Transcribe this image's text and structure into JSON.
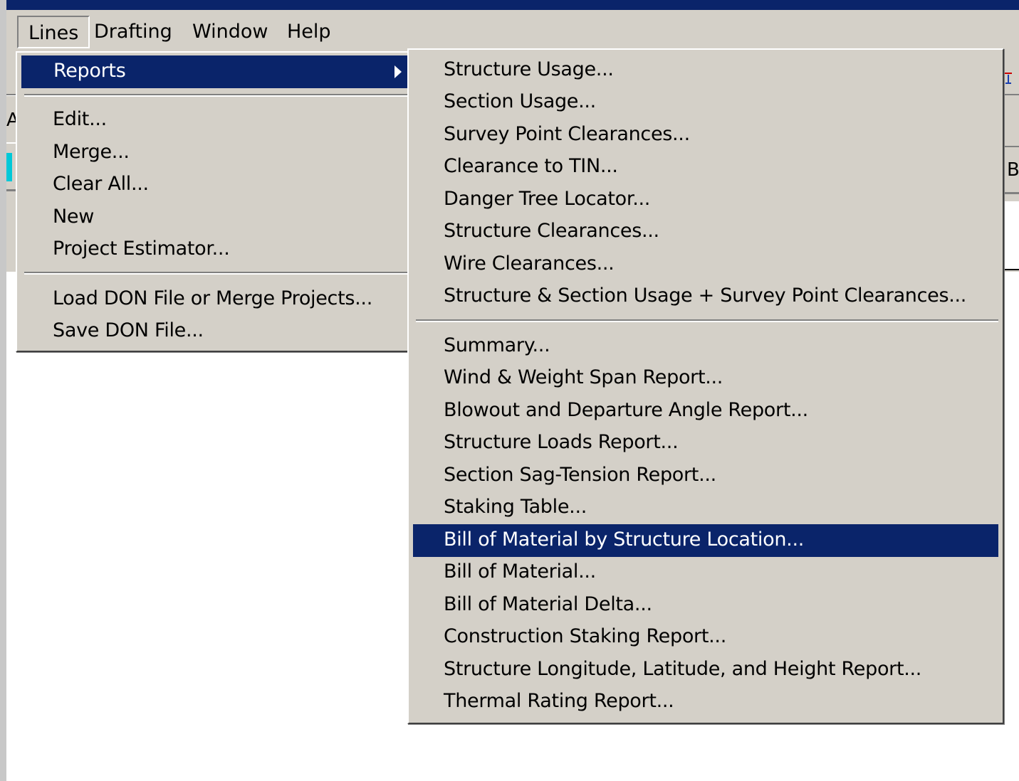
{
  "menubar": {
    "items": [
      {
        "label": "Lines"
      },
      {
        "label": "Drafting"
      },
      {
        "label": "Window"
      },
      {
        "label": "Help"
      }
    ]
  },
  "background": {
    "left_edge_text": "Al",
    "right_edge_text": "B"
  },
  "lines_menu": {
    "reports": "Reports",
    "edit": "Edit...",
    "merge": "Merge...",
    "clear_all": "Clear All...",
    "new": "New",
    "project_estimator": "Project Estimator...",
    "load_don": "Load DON File or Merge Projects...",
    "save_don": "Save DON File..."
  },
  "reports_menu": {
    "items": [
      "Structure Usage...",
      "Section Usage...",
      "Survey Point Clearances...",
      "Clearance to TIN...",
      "Danger Tree Locator...",
      "Structure Clearances...",
      "Wire Clearances...",
      "Structure & Section Usage + Survey Point Clearances...",
      "Summary...",
      "Wind & Weight Span Report...",
      "Blowout and Departure Angle Report...",
      "Structure Loads Report...",
      "Section Sag-Tension Report...",
      "Staking Table...",
      "Bill of Material by Structure Location...",
      "Bill of Material...",
      "Bill of Material Delta...",
      "Construction Staking Report...",
      "Structure Longitude, Latitude, and Height Report...",
      "Thermal Rating Report..."
    ],
    "highlighted": "Bill of Material by Structure Location..."
  },
  "colors": {
    "menu_face": "#d4d0c8",
    "highlight": "#0a246a",
    "highlight_text": "#ffffff"
  }
}
